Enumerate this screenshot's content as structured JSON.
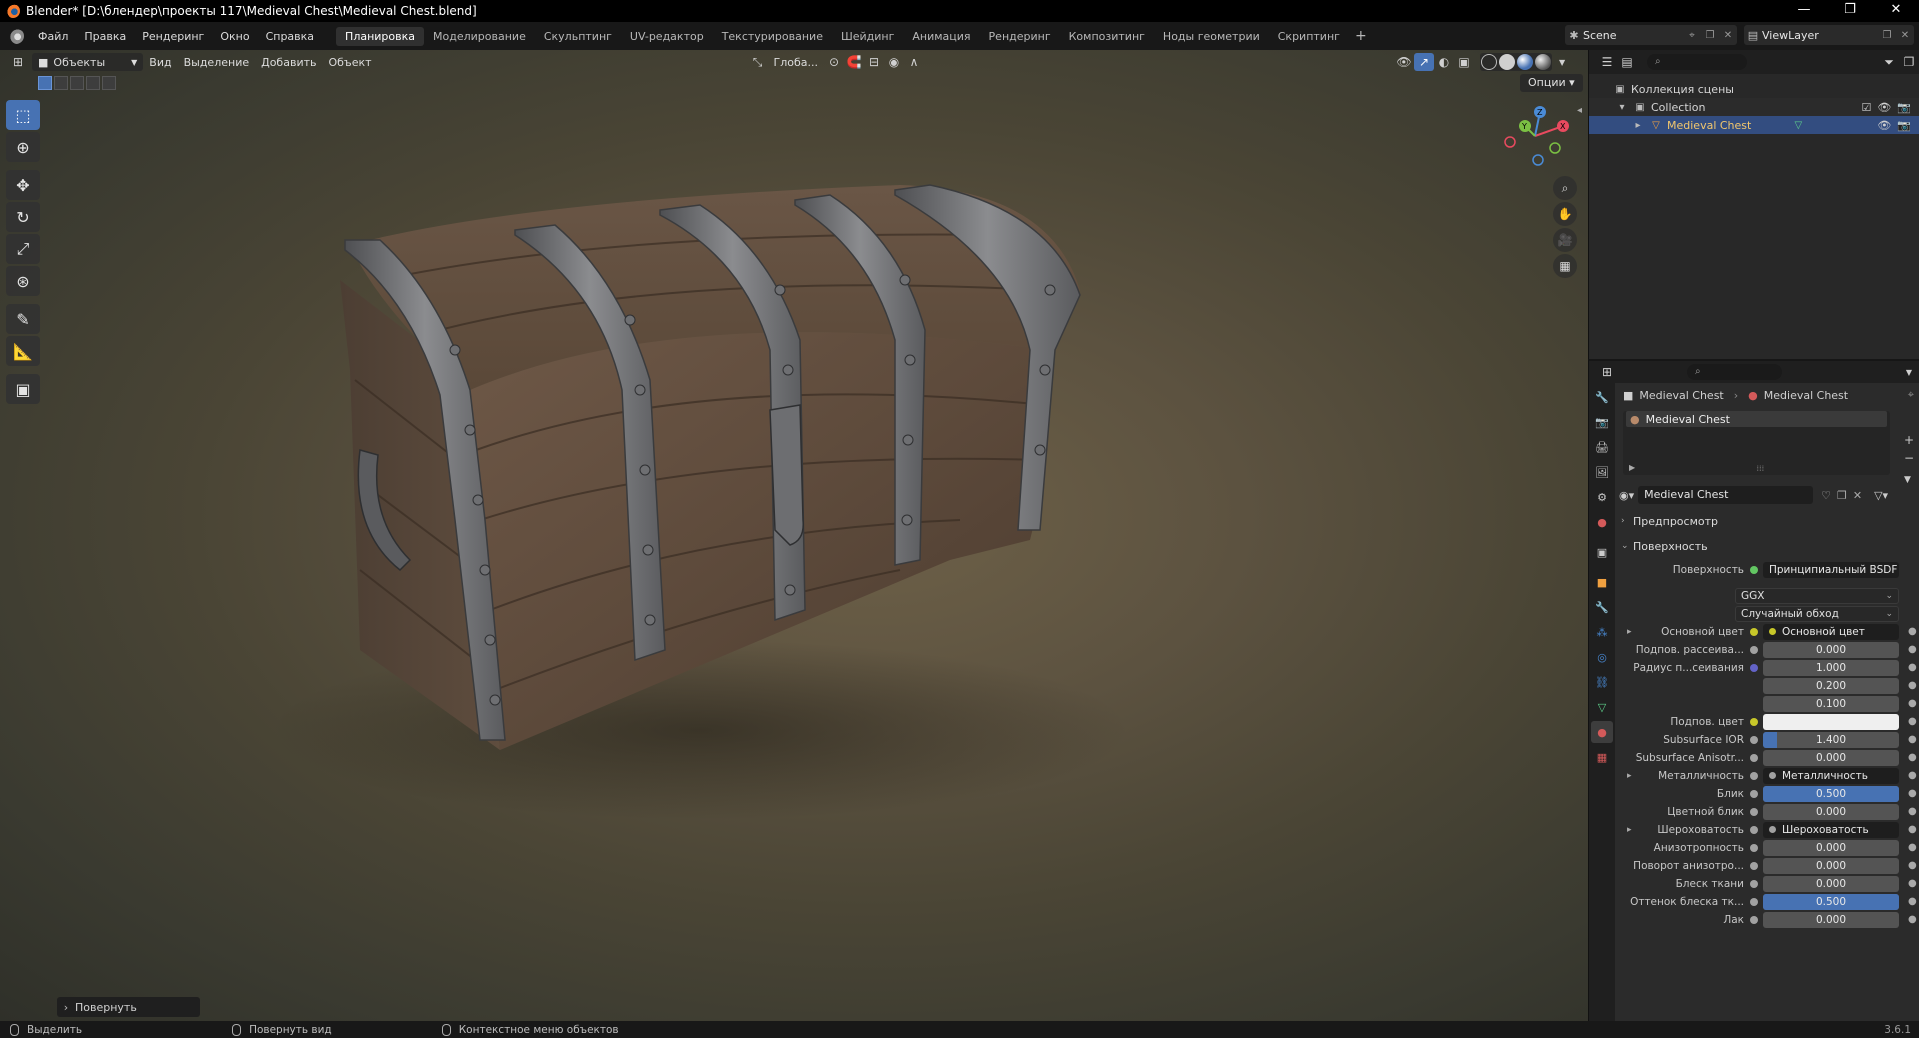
{
  "window": {
    "title": "Blender* [D:\\блендер\\проекты 117\\Medieval Chest\\Medieval Chest.blend]",
    "minimize": "—",
    "maximize": "❐",
    "close": "✕"
  },
  "menubar": {
    "menus": [
      "Файл",
      "Правка",
      "Рендеринг",
      "Окно",
      "Справка"
    ],
    "workspaces": [
      "Планировка",
      "Моделирование",
      "Скульптинг",
      "UV-редактор",
      "Текстурирование",
      "Шейдинг",
      "Анимация",
      "Рендеринг",
      "Композитинг",
      "Ноды геометрии",
      "Скриптинг"
    ],
    "active_workspace": "Планировка",
    "add_workspace": "+",
    "scene_name": "Scene",
    "view_layer": "ViewLayer"
  },
  "viewport": {
    "mode": "Объекты",
    "menus": [
      "Вид",
      "Выделение",
      "Добавить",
      "Объект"
    ],
    "transform_orientation": "Глоба...",
    "options_label": "Опции",
    "gizmo": {
      "x": "X",
      "y": "Y",
      "z": "Z"
    },
    "last_operator": "Повернуть",
    "accent": "#4772b3"
  },
  "outliner": {
    "root": "Коллекция сцены",
    "collection": "Collection",
    "object": "Medieval Chest"
  },
  "properties": {
    "breadcrumb_object": "Medieval Chest",
    "breadcrumb_material": "Medieval Chest",
    "slot_name": "Medieval Chest",
    "material_name": "Medieval Chest",
    "panel_preview": "Предпросмотр",
    "panel_surface": "Поверхность",
    "surface_label": "Поверхность",
    "surface_value": "Принципиальный BSDF",
    "distribution": "GGX",
    "subsurface_method": "Случайный обход",
    "rows": [
      {
        "label": "Основной цвет",
        "value": "Основной цвет",
        "kind": "link",
        "socket": "yellow",
        "expand": true
      },
      {
        "label": "Подпов. рассеива...",
        "value": "0.000",
        "kind": "num",
        "socket": "grey",
        "fill": 0
      },
      {
        "label": "Радиус п...сеивания",
        "value": "1.000",
        "kind": "num",
        "socket": "blue",
        "fill": 0
      },
      {
        "label": "",
        "value": "0.200",
        "kind": "num",
        "socket": "",
        "fill": 0
      },
      {
        "label": "",
        "value": "0.100",
        "kind": "num",
        "socket": "",
        "fill": 0
      },
      {
        "label": "Подпов. цвет",
        "value": "",
        "kind": "color",
        "socket": "yellow"
      },
      {
        "label": "Subsurface IOR",
        "value": "1.400",
        "kind": "num",
        "socket": "grey",
        "fill": 0.1
      },
      {
        "label": "Subsurface Anisotr...",
        "value": "0.000",
        "kind": "num",
        "socket": "grey",
        "fill": 0
      },
      {
        "label": "Металличность",
        "value": "Металличность",
        "kind": "link",
        "socket": "grey",
        "expand": true
      },
      {
        "label": "Блик",
        "value": "0.500",
        "kind": "num",
        "socket": "grey",
        "fill": 1
      },
      {
        "label": "Цветной блик",
        "value": "0.000",
        "kind": "num",
        "socket": "grey",
        "fill": 0
      },
      {
        "label": "Шероховатость",
        "value": "Шероховатость",
        "kind": "link",
        "socket": "grey",
        "expand": true
      },
      {
        "label": "Анизотропность",
        "value": "0.000",
        "kind": "num",
        "socket": "grey",
        "fill": 0
      },
      {
        "label": "Поворот анизотро...",
        "value": "0.000",
        "kind": "num",
        "socket": "grey",
        "fill": 0
      },
      {
        "label": "Блеск ткани",
        "value": "0.000",
        "kind": "num",
        "socket": "grey",
        "fill": 0
      },
      {
        "label": "Оттенок блеска тк...",
        "value": "0.500",
        "kind": "num",
        "socket": "grey",
        "fill": 1
      },
      {
        "label": "Лак",
        "value": "0.000",
        "kind": "num",
        "socket": "grey",
        "fill": 0
      }
    ]
  },
  "statusbar": {
    "select": "Выделить",
    "rotate_view": "Повернуть вид",
    "context_menu": "Контекстное меню объектов",
    "version": "3.6.1"
  }
}
